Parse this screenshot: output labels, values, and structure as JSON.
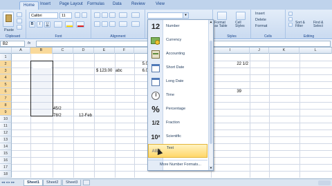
{
  "ribbon": {
    "tabs": [
      "Home",
      "Insert",
      "Page Layout",
      "Formulas",
      "Data",
      "Review",
      "View"
    ],
    "active_tab": "Home",
    "clipboard": {
      "paste": "Paste",
      "group": "Clipboard"
    },
    "font": {
      "name": "Calibri",
      "size": "11",
      "group": "Font",
      "bold": "B",
      "italic": "I",
      "underline": "U"
    },
    "alignment": {
      "group": "Alignment"
    },
    "styles": {
      "format_table": "Format\nas Table",
      "cell_styles": "Cell\nStyles",
      "group": "Styles"
    },
    "cells": {
      "insert": "Insert",
      "delete": "Delete",
      "format": "Format",
      "group": "Cells"
    },
    "editing": {
      "sort": "Sort &\nFilter",
      "find": "Find &\nSelect",
      "group": "Editing"
    }
  },
  "formula_bar": {
    "name_box": "B2",
    "fx": "fx"
  },
  "grid": {
    "columns": [
      "A",
      "B",
      "C",
      "D",
      "E",
      "F",
      "",
      "",
      "",
      "I",
      "J",
      "K",
      "L"
    ],
    "rows": [
      "1",
      "2",
      "3",
      "4",
      "5",
      "6",
      "7",
      "8",
      "9",
      "10",
      "11",
      "12",
      "13",
      "14",
      "15",
      "16",
      "17",
      "18"
    ],
    "cells": {
      "c_10": "45/2",
      "c_11": "78/2",
      "d_11": "12-Feb",
      "e_3": "$ 123.00",
      "f_3": "abc",
      "g_2": "5.0",
      "g_3": "6.0",
      "i_2": "22 1/2",
      "i_6": "39"
    }
  },
  "number_format_dropdown": {
    "items": [
      {
        "label": "Number",
        "icon": "12"
      },
      {
        "label": "Currency",
        "icon": "currency"
      },
      {
        "label": "Accounting",
        "icon": "accounting"
      },
      {
        "label": "Short Date",
        "icon": "short-date"
      },
      {
        "label": "Long Date",
        "icon": "long-date"
      },
      {
        "label": "Time",
        "icon": "clock"
      },
      {
        "label": "Percentage",
        "icon": "%"
      },
      {
        "label": "Fraction",
        "icon": "1/2"
      },
      {
        "label": "Scientific",
        "icon": "10²"
      },
      {
        "label": "Text",
        "icon": "ABC"
      }
    ],
    "more": "More Number Formats..."
  },
  "sheets": [
    "Sheet1",
    "Sheet2",
    "Sheet3"
  ],
  "active_sheet": "Sheet1"
}
